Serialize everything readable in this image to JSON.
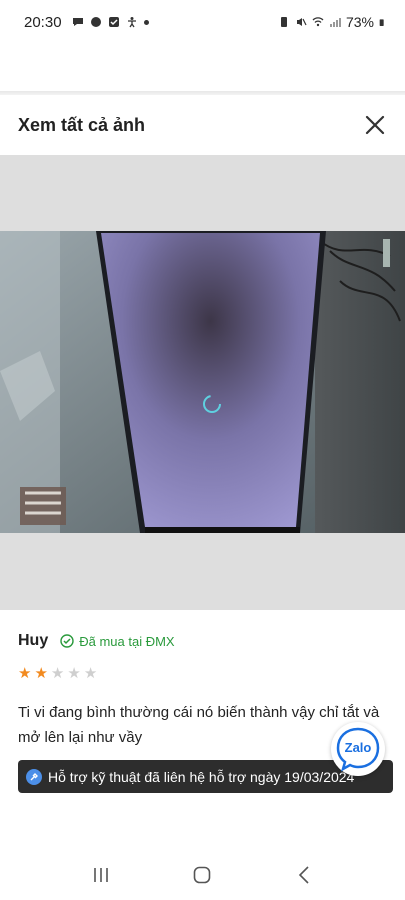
{
  "status_bar": {
    "time": "20:30",
    "battery": "73%",
    "icons": [
      "chat-bubble-icon",
      "message-icon",
      "checkbox-icon",
      "accessibility-icon",
      "battery-saver-icon",
      "mute-icon",
      "wifi-icon",
      "signal-icon",
      "battery-icon"
    ]
  },
  "sheet": {
    "title": "Xem tất cả ảnh",
    "close_icon": "close-icon"
  },
  "photo": {
    "description_icon": "loading-spinner-icon",
    "spinner_color": "#5fd0e0"
  },
  "review": {
    "name": "Huy",
    "verified_label": "Đã mua tại ĐMX",
    "rating": 2,
    "max_rating": 5,
    "text": "Ti vi đang bình thường cái nó biến thành vậy chỉ tắt và mở lên lại như vầy",
    "support_text": "Hỗ trợ kỹ thuật đã liên hệ hỗ trợ ngày 19/03/2024"
  },
  "zalo": {
    "label": "Zalo"
  },
  "colors": {
    "star_on": "#f28a1f",
    "star_off": "#cfcfcf",
    "verified": "#2a9a3c",
    "support_bg": "#2d2d2d"
  },
  "nav": [
    "recent-apps-icon",
    "home-icon",
    "back-icon"
  ]
}
